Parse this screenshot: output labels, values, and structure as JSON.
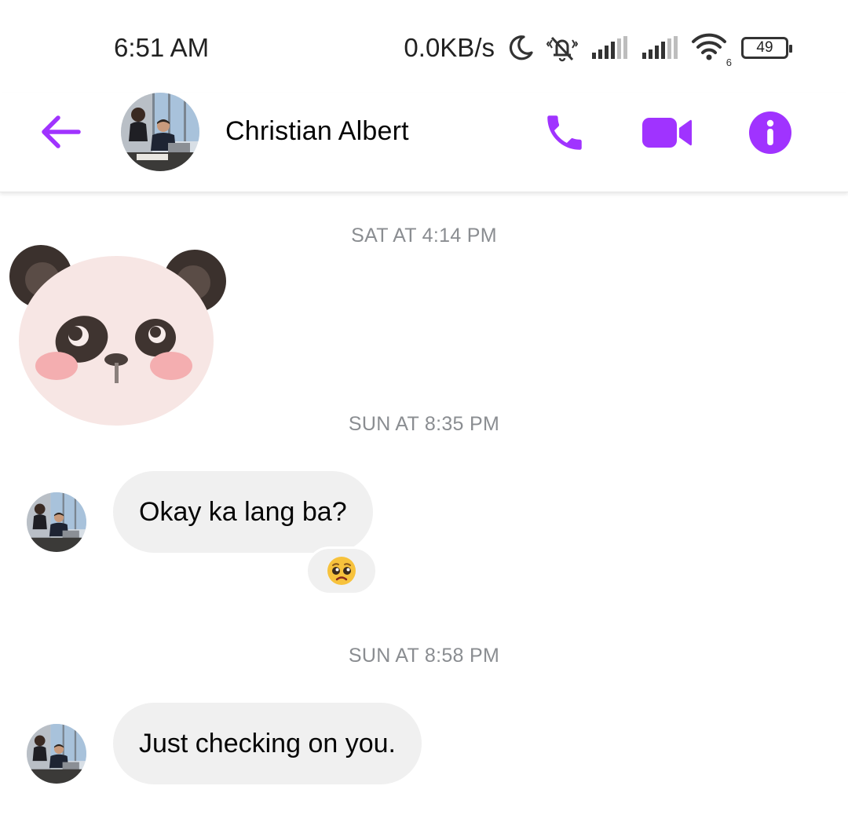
{
  "status_bar": {
    "time": "6:51 AM",
    "net_speed": "0.0KB/s",
    "wifi_badge": "6",
    "battery": "49",
    "icons": [
      "moon-icon",
      "muted-bell-icon",
      "signal-icon",
      "signal-icon",
      "wifi-icon",
      "battery-icon"
    ]
  },
  "header": {
    "contact_name": "Christian Albert",
    "back_icon": "back-arrow-icon",
    "call_icon": "phone-icon",
    "video_icon": "video-camera-icon",
    "info_icon": "info-icon",
    "accent_color": "#a033ff"
  },
  "messages": {
    "timestamp_1": "SAT AT 4:14 PM",
    "sticker": "panda-sticker",
    "timestamp_2": "SUN AT 8:35 PM",
    "message_1": "Okay ka lang ba?",
    "reaction_1": "pleading-face-emoji",
    "timestamp_3": "SUN AT 8:58 PM",
    "message_2": "Just checking on you."
  },
  "colors": {
    "bubble": "#f0f0f0",
    "timestamp": "#8a8d91",
    "text": "#050505"
  }
}
